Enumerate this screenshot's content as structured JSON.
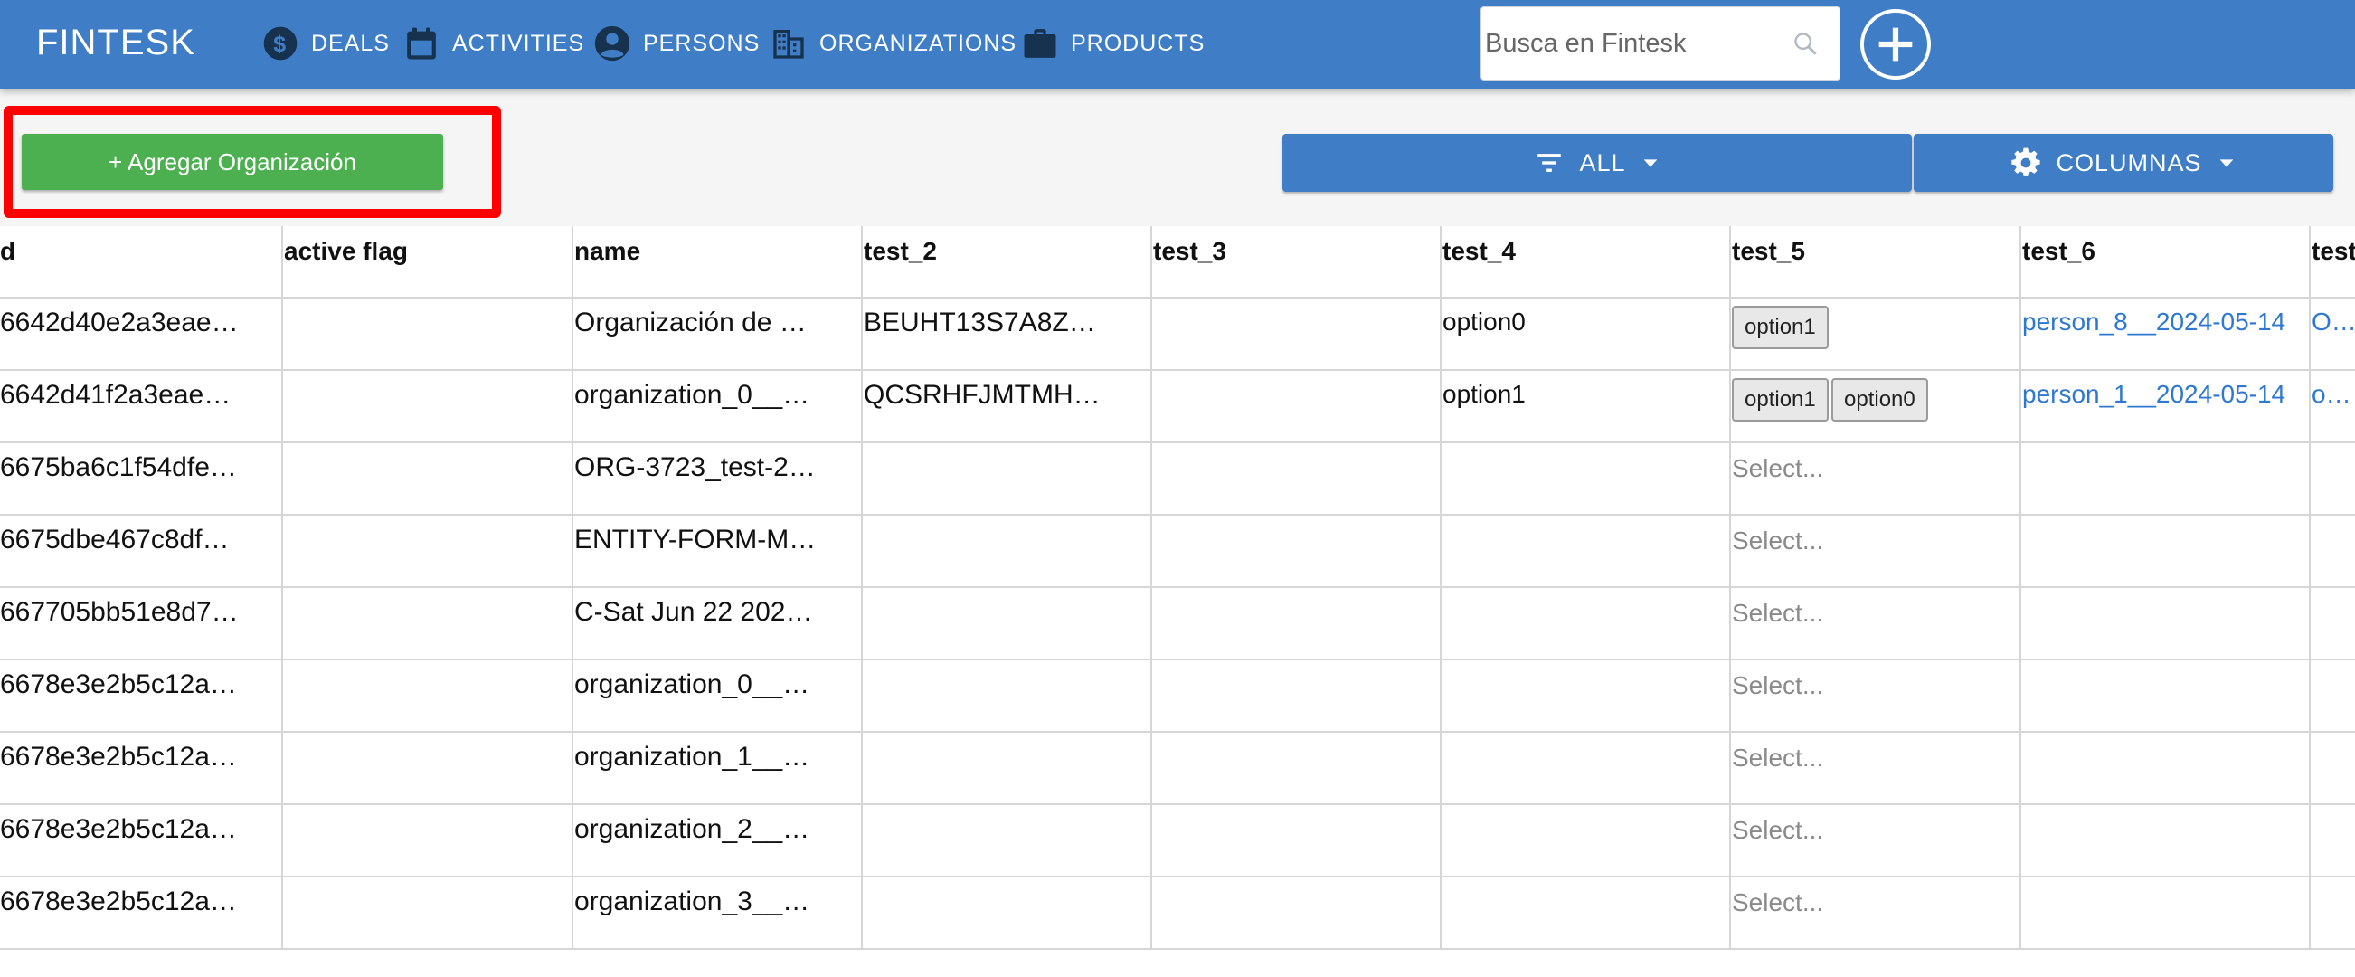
{
  "navbar": {
    "brand": "FINTESK",
    "items": [
      {
        "label": "DEALS",
        "icon": "dollar-circle-icon"
      },
      {
        "label": "ACTIVITIES",
        "icon": "calendar-icon"
      },
      {
        "label": "PERSONS",
        "icon": "person-circle-icon"
      },
      {
        "label": "ORGANIZATIONS",
        "icon": "building-icon"
      },
      {
        "label": "PRODUCTS",
        "icon": "briefcase-icon"
      }
    ],
    "search_placeholder": "Busca en Fintesk",
    "color": "#3f7ec6"
  },
  "toolbar": {
    "add_label": "+ Agregar Organización",
    "filter_label": "ALL",
    "columns_label": "COLUMNAS",
    "add_color": "#4caf50",
    "highlight_color": "#ff0000"
  },
  "table": {
    "headers": [
      "d",
      "active flag",
      "name",
      "test_2",
      "test_3",
      "test_4",
      "test_5",
      "test_6",
      "test"
    ],
    "select_placeholder": "Select...",
    "rows": [
      {
        "id": "6642d40e2a3eae…",
        "name": "Organización de …",
        "test_2": "BEUHT13S7A8Z…",
        "test_4": "option0",
        "test_5": [
          "option1"
        ],
        "test_6": "person_8__2024-05-14",
        "test_7": "Orga"
      },
      {
        "id": "6642d41f2a3eae…",
        "name": "organization_0__…",
        "test_2": "QCSRHFJMTMH…",
        "test_4": "option1",
        "test_5": [
          "option1",
          "option0"
        ],
        "test_6": "person_1__2024-05-14",
        "test_7": "orga"
      },
      {
        "id": "6675ba6c1f54dfe…",
        "name": "ORG-3723_test-2…"
      },
      {
        "id": "6675dbe467c8df…",
        "name": "ENTITY-FORM-M…"
      },
      {
        "id": "667705bb51e8d7…",
        "name": "C-Sat Jun 22 202…"
      },
      {
        "id": "6678e3e2b5c12a…",
        "name": "organization_0__…"
      },
      {
        "id": "6678e3e2b5c12a…",
        "name": "organization_1__…"
      },
      {
        "id": "6678e3e2b5c12a…",
        "name": "organization_2__…"
      },
      {
        "id": "6678e3e2b5c12a…",
        "name": "organization_3__…"
      }
    ]
  }
}
